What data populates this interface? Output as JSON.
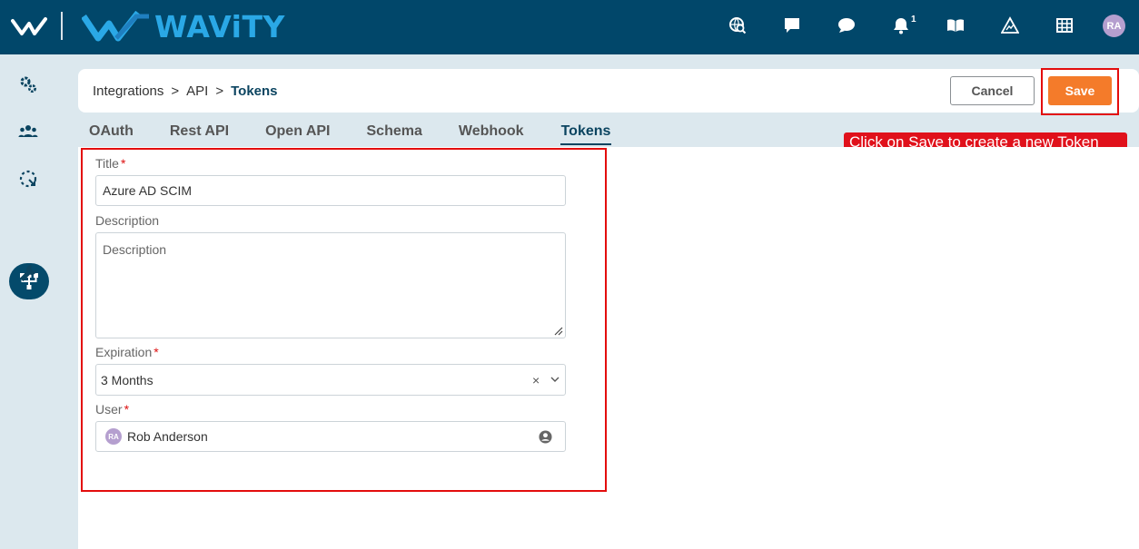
{
  "brand": {
    "name": "WAViTY",
    "accent": "#2aa8e6",
    "bar_color": "#01476a"
  },
  "topbar": {
    "icons": [
      "search-globe-icon",
      "chat-icon",
      "comment-icon",
      "bell-icon",
      "book-icon",
      "warning-icon",
      "grid-icon"
    ],
    "notification_count": "1",
    "user_initials": "RA"
  },
  "sidebar": {
    "icons": [
      "settings-gears-icon",
      "users-group-icon",
      "loading-dashed-icon",
      "integrations-icon",
      "wrench-icon"
    ],
    "active": "integrations-icon"
  },
  "breadcrumb": {
    "items": [
      "Integrations",
      ">",
      "API",
      ">"
    ],
    "current": "Tokens"
  },
  "actions": {
    "cancel_label": "Cancel",
    "save_label": "Save",
    "save_color": "#f47b2a"
  },
  "callout": {
    "text": "Click on Save to create a new Token",
    "color": "#e0111b"
  },
  "tabs": [
    {
      "label": "OAuth"
    },
    {
      "label": "Rest API"
    },
    {
      "label": "Open API"
    },
    {
      "label": "Schema"
    },
    {
      "label": "Webhook"
    },
    {
      "label": "Tokens",
      "active": true
    }
  ],
  "form": {
    "title": {
      "label": "Title",
      "required": "*",
      "value": "Azure AD SCIM"
    },
    "description": {
      "label": "Description",
      "placeholder": "Description"
    },
    "expiration": {
      "label": "Expiration",
      "required": "*",
      "value": "3 Months",
      "clear": "×"
    },
    "user": {
      "label": "User",
      "required": "*",
      "value": "Rob Anderson",
      "initials": "RA"
    }
  }
}
